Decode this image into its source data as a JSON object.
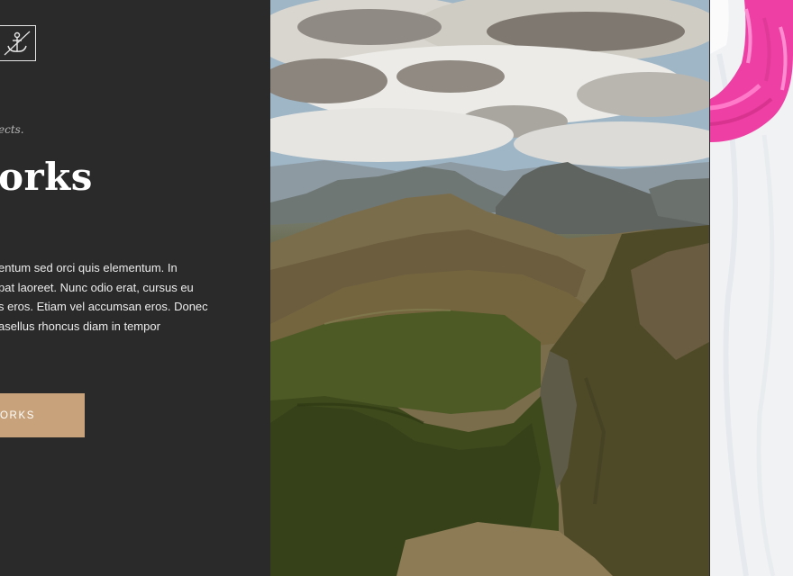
{
  "hero": {
    "eyebrow": "ects.",
    "headline": "orks",
    "body_lines": [
      "entum sed orci quis elementum. In",
      "pat laoreet. Nunc odio erat, cursus eu",
      "s eros. Etiam vel accumsan eros. Donec",
      "asellus rhoncus diam in tempor"
    ],
    "cta_label": "ORKS"
  },
  "logo": {
    "icon": "anchor-icon"
  },
  "colors": {
    "panel_background": "#2a2a2a",
    "accent": "#c7a27a",
    "headline": "#ffffff"
  },
  "gallery": {
    "images": [
      {
        "subject": "mountain-landscape-photo"
      },
      {
        "subject": "pink-knit-on-white-fur-photo"
      }
    ]
  }
}
